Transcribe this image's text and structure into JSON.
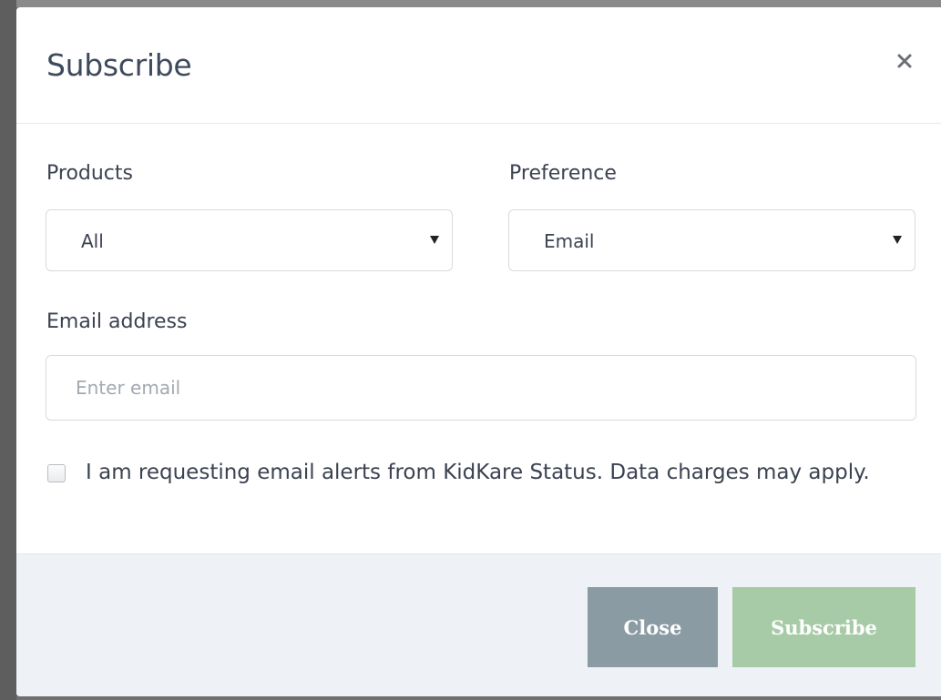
{
  "modal": {
    "title": "Subscribe",
    "close_icon": "close-icon"
  },
  "form": {
    "products_label": "Products",
    "products_value": "All",
    "preference_label": "Preference",
    "preference_value": "Email",
    "email_label": "Email address",
    "email_placeholder": "Enter email",
    "email_value": "",
    "consent_text": "I am requesting email alerts from KidKare Status. Data charges may apply.",
    "consent_checked": false
  },
  "footer": {
    "close_label": "Close",
    "subscribe_label": "Subscribe"
  },
  "colors": {
    "title": "#3e4a5c",
    "close_button": "#8a9ba4",
    "subscribe_button": "#a7cba7",
    "footer_bg": "#eef1f5"
  }
}
